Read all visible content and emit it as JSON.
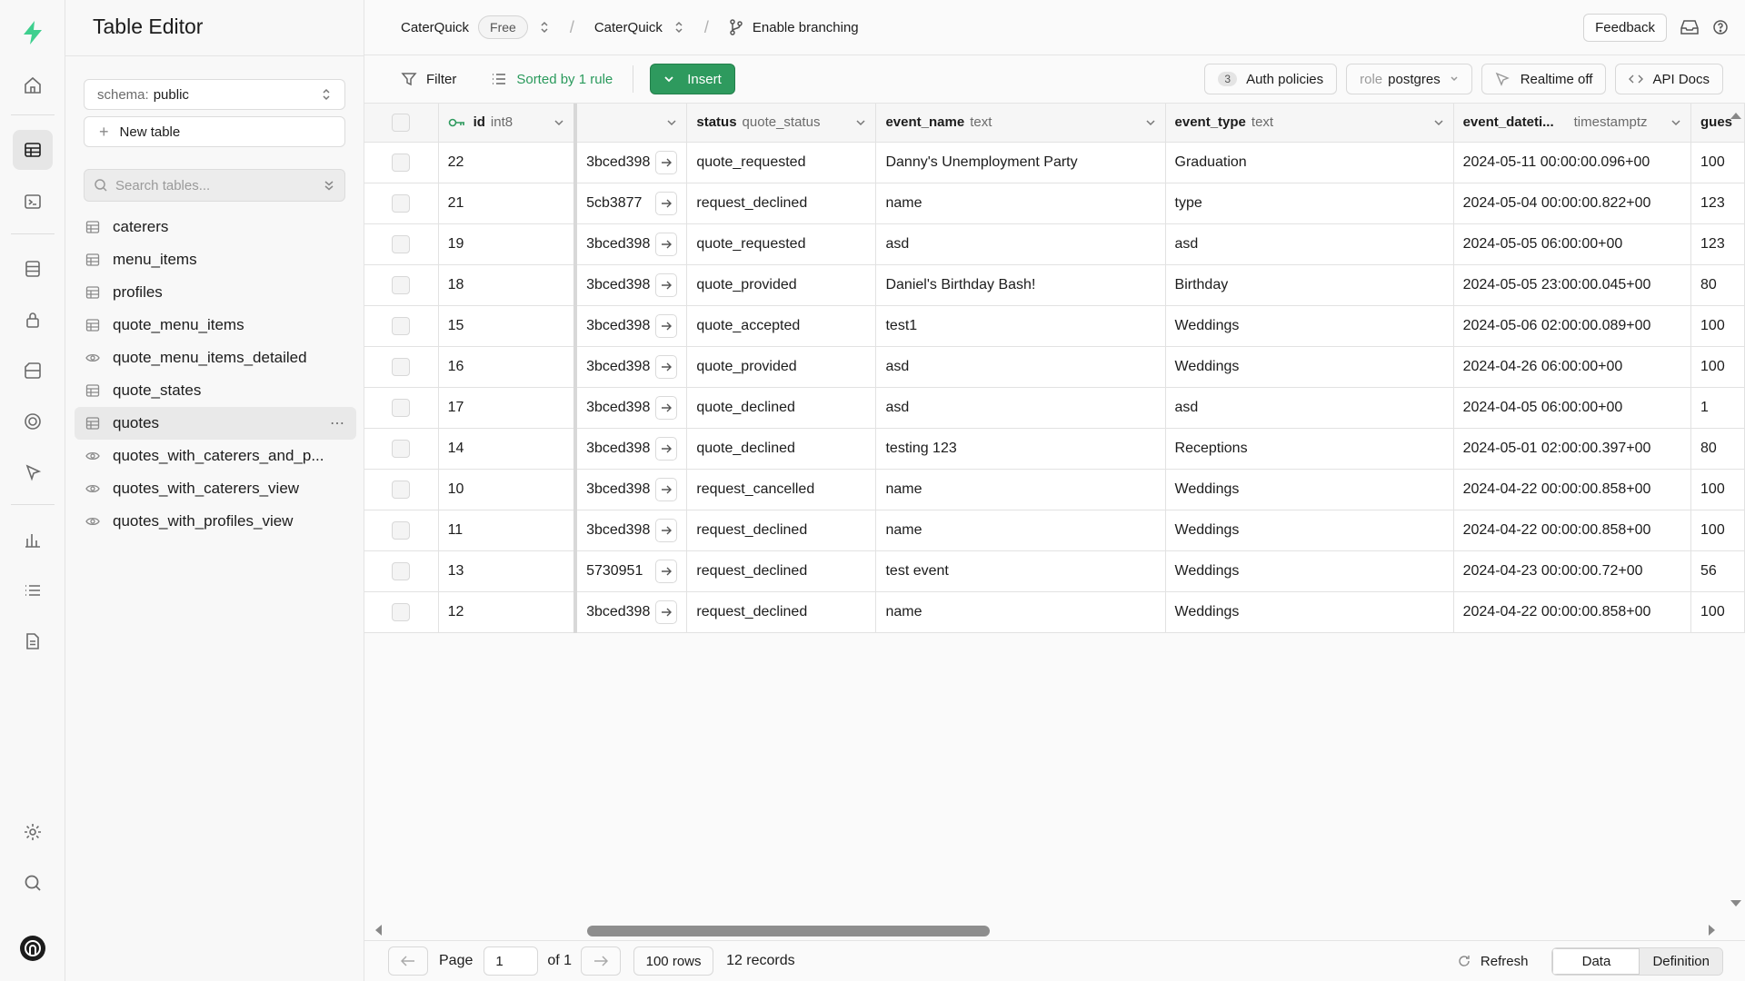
{
  "rail": {
    "icons": [
      "logo-icon",
      "home-icon",
      "table-editor-icon",
      "sql-editor-icon",
      "database-icon",
      "auth-icon",
      "storage-icon",
      "realtime-icon",
      "edge-functions-icon",
      "reports-icon",
      "logs-icon",
      "docs-icon",
      "settings-icon",
      "search-icon",
      "user-avatar-icon"
    ]
  },
  "sidebar": {
    "title": "Table Editor",
    "schema_label": "schema:",
    "schema_value": "public",
    "new_table": "New table",
    "search_placeholder": "Search tables...",
    "items": [
      {
        "label": "caterers",
        "kind": "table"
      },
      {
        "label": "menu_items",
        "kind": "table"
      },
      {
        "label": "profiles",
        "kind": "table"
      },
      {
        "label": "quote_menu_items",
        "kind": "table"
      },
      {
        "label": "quote_menu_items_detailed",
        "kind": "view"
      },
      {
        "label": "quote_states",
        "kind": "table"
      },
      {
        "label": "quotes",
        "kind": "table",
        "active": true
      },
      {
        "label": "quotes_with_caterers_and_p...",
        "kind": "view"
      },
      {
        "label": "quotes_with_caterers_view",
        "kind": "view"
      },
      {
        "label": "quotes_with_profiles_view",
        "kind": "view"
      }
    ]
  },
  "topbar": {
    "org": "CaterQuick",
    "plan": "Free",
    "project": "CaterQuick",
    "branching": "Enable branching",
    "feedback": "Feedback"
  },
  "toolbar": {
    "filter": "Filter",
    "sorted": "Sorted by 1 rule",
    "insert": "Insert",
    "auth_count": "3",
    "auth_policies": "Auth policies",
    "role_label": "role",
    "role_value": "postgres",
    "realtime": "Realtime off",
    "api_docs": "API Docs"
  },
  "grid": {
    "columns": [
      {
        "name": "id",
        "type": "int8"
      },
      {
        "name": "",
        "type": ""
      },
      {
        "name": "status",
        "type": "quote_status"
      },
      {
        "name": "event_name",
        "type": "text"
      },
      {
        "name": "event_type",
        "type": "text"
      },
      {
        "name": "event_dateti...",
        "type": "timestamptz"
      },
      {
        "name": "gues",
        "type": ""
      }
    ],
    "rows": [
      {
        "id": "22",
        "fk": "3bced398",
        "status": "quote_requested",
        "event_name": "Danny's Unemployment Party",
        "event_type": "Graduation",
        "event_datetime": "2024-05-11 00:00:00.096+00",
        "guests": "100"
      },
      {
        "id": "21",
        "fk": "5cb3877",
        "status": "request_declined",
        "event_name": "name",
        "event_type": "type",
        "event_datetime": "2024-05-04 00:00:00.822+00",
        "guests": "123"
      },
      {
        "id": "19",
        "fk": "3bced398",
        "status": "quote_requested",
        "event_name": "asd",
        "event_type": "asd",
        "event_datetime": "2024-05-05 06:00:00+00",
        "guests": "123"
      },
      {
        "id": "18",
        "fk": "3bced398",
        "status": "quote_provided",
        "event_name": "Daniel's Birthday Bash!",
        "event_type": "Birthday",
        "event_datetime": "2024-05-05 23:00:00.045+00",
        "guests": "80"
      },
      {
        "id": "15",
        "fk": "3bced398",
        "status": "quote_accepted",
        "event_name": "test1",
        "event_type": "Weddings",
        "event_datetime": "2024-05-06 02:00:00.089+00",
        "guests": "100"
      },
      {
        "id": "16",
        "fk": "3bced398",
        "status": "quote_provided",
        "event_name": "asd",
        "event_type": "Weddings",
        "event_datetime": "2024-04-26 06:00:00+00",
        "guests": "100"
      },
      {
        "id": "17",
        "fk": "3bced398",
        "status": "quote_declined",
        "event_name": "asd",
        "event_type": "asd",
        "event_datetime": "2024-04-05 06:00:00+00",
        "guests": "1"
      },
      {
        "id": "14",
        "fk": "3bced398",
        "status": "quote_declined",
        "event_name": "testing 123",
        "event_type": "Receptions",
        "event_datetime": "2024-05-01 02:00:00.397+00",
        "guests": "80"
      },
      {
        "id": "10",
        "fk": "3bced398",
        "status": "request_cancelled",
        "event_name": "name",
        "event_type": "Weddings",
        "event_datetime": "2024-04-22 00:00:00.858+00",
        "guests": "100"
      },
      {
        "id": "11",
        "fk": "3bced398",
        "status": "request_declined",
        "event_name": "name",
        "event_type": "Weddings",
        "event_datetime": "2024-04-22 00:00:00.858+00",
        "guests": "100"
      },
      {
        "id": "13",
        "fk": "5730951",
        "status": "request_declined",
        "event_name": "test event",
        "event_type": "Weddings",
        "event_datetime": "2024-04-23 00:00:00.72+00",
        "guests": "56"
      },
      {
        "id": "12",
        "fk": "3bced398",
        "status": "request_declined",
        "event_name": "name",
        "event_type": "Weddings",
        "event_datetime": "2024-04-22 00:00:00.858+00",
        "guests": "100"
      }
    ]
  },
  "footer": {
    "page_label": "Page",
    "page_value": "1",
    "of_label": "of 1",
    "rows_label": "100 rows",
    "records": "12 records",
    "refresh": "Refresh",
    "view_data": "Data",
    "view_definition": "Definition"
  },
  "colors": {
    "accent": "#2e9a5e",
    "brand": "#3ecf8e"
  }
}
